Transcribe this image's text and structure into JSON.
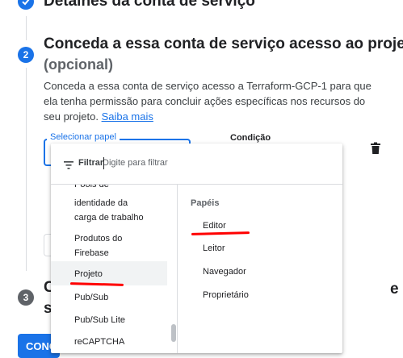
{
  "step1": {
    "title": "Detalhes da conta de serviço"
  },
  "step2": {
    "number": "2",
    "title": "Conceda a essa conta de serviço acesso ao projeto",
    "optional": "(opcional)",
    "description": "Conceda a essa conta de serviço acesso a Terraform-GCP-1 para que ela tenha permissão para concluir ações específicas nos recursos do seu projeto.",
    "learn_more": "Saiba mais",
    "role_label": "Selecionar papel",
    "condition_label": "Condição"
  },
  "step3": {
    "number": "3",
    "title_start": "C",
    "title_line2_start": "s",
    "title_end": "e"
  },
  "continue_button": "CONC",
  "dropdown": {
    "filter_label": "Filtrar",
    "filter_placeholder": "Digite para filtrar",
    "services": [
      "Pools de",
      "identidade da",
      "carga de trabalho",
      "Produtos do",
      "Firebase",
      "Projeto",
      "Pub/Sub",
      "Pub/Sub Lite",
      "reCAPTCHA"
    ],
    "selected_service": "Projeto",
    "roles_header": "Papéis",
    "roles": [
      "Editor",
      "Leitor",
      "Navegador",
      "Proprietário"
    ]
  },
  "colors": {
    "accent": "#1a73e8",
    "annotation": "#ff0000"
  }
}
